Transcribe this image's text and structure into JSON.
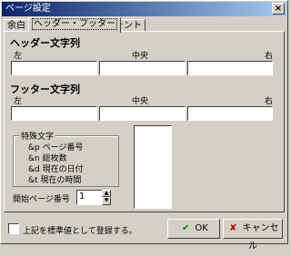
{
  "window": {
    "title": "ページ設定",
    "close_label": "×"
  },
  "tabs": [
    {
      "label": "余白"
    },
    {
      "label": "ヘッダー・フッター"
    },
    {
      "label": "フォント"
    }
  ],
  "header_section": {
    "title": "ヘッダー文字列",
    "left_label": "左",
    "center_label": "中央",
    "right_label": "右",
    "left_value": "",
    "center_value": "",
    "right_value": ""
  },
  "footer_section": {
    "title": "フッター文字列",
    "left_label": "左",
    "center_label": "中央",
    "right_label": "右",
    "left_value": "",
    "center_value": "",
    "right_value": ""
  },
  "special_chars": {
    "title": "特殊文字",
    "items": [
      {
        "code": "&p",
        "label": "ページ番号"
      },
      {
        "code": "&n",
        "label": "総枚数"
      },
      {
        "code": "&d",
        "label": "現在の日付"
      },
      {
        "code": "&t",
        "label": "現在の時間"
      }
    ]
  },
  "start_page": {
    "label": "開始ページ番号",
    "value": "1",
    "up_glyph": "▲",
    "down_glyph": "▼"
  },
  "footer": {
    "checkbox_label": "上記を標準値として登録する。",
    "ok_label": "OK",
    "ok_icon_glyph": "✔",
    "cancel_label": "キャンセル",
    "cancel_icon_glyph": "✘",
    "ok_icon_color": "#008000",
    "cancel_icon_color": "#c00000"
  }
}
